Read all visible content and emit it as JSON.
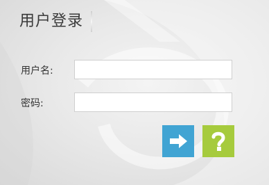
{
  "login": {
    "title": "用户登录",
    "username_label": "用户名:",
    "username_value": "",
    "password_label": "密码:",
    "password_value": "",
    "submit_icon": "arrow-right-icon",
    "help_icon": "question-mark-icon"
  },
  "colors": {
    "submit_bg": "#41a4d3",
    "help_bg": "#a6cb3d",
    "icon_fg": "#ffffff"
  }
}
